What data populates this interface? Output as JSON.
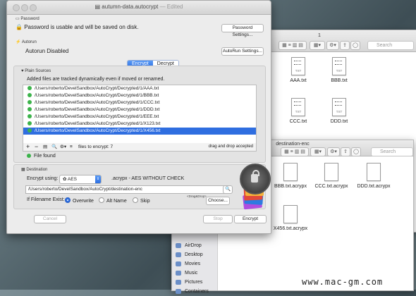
{
  "window": {
    "title": "autumn-data.autocrypt",
    "edited": "— Edited"
  },
  "password": {
    "header": "Password",
    "status": "Password is usable and will be saved on disk.",
    "settings_button": "Password Settings..."
  },
  "autorun": {
    "header": "Autorun",
    "status": "Autorun Disabled",
    "settings_button": "AutoRun Settings..."
  },
  "mode_tabs": [
    {
      "label": "Encrypt",
      "selected": true
    },
    {
      "label": "Decrypt",
      "selected": false
    }
  ],
  "plain_sources": {
    "header": "Plain Sources",
    "note": "Added files are tracked dynamically  even if moved or renamed.",
    "files": [
      "/Users/roberto/DevelSandbox/AutoCrypt/Decrypted/1/AAA.txt",
      "/Users/roberto/DevelSandbox/AutoCrypt/Decrypted/1/BBB.txt",
      "/Users/roberto/DevelSandbox/AutoCrypt/Decrypted/1/CCC.txt",
      "/Users/roberto/DevelSandbox/AutoCrypt/Decrypted/1/DDD.txt",
      "/Users/roberto/DevelSandbox/AutoCrypt/Decrypted/1/EEE.txt",
      "/Users/roberto/DevelSandbox/AutoCrypt/Decrypted/1/X123.txt",
      "/Users/roberto/DevelSandbox/AutoCrypt/Decrypted/1/X456.txt"
    ],
    "selected_index": 6,
    "add_label": "+",
    "remove_label": "−",
    "files_count": "files to encrypt: 7",
    "drag_hint": "drag and drop accepted",
    "status": "File found"
  },
  "destination": {
    "header": "Destination",
    "encrypt_using_label": "Encrypt using:",
    "algorithm": "AES",
    "extension_note": ".acrypx - AES WITHOUT CHECK",
    "path": "/Users/roberto/DevelSandbox/AutoCrypt/destination-enc",
    "drag_drop_tag": "<Drag&Drop>",
    "choose_button": "Choose...",
    "if_exists_label": "If Filename Exist:",
    "options": [
      {
        "label": "Overwrite",
        "selected": true
      },
      {
        "label": "Alt Name",
        "selected": false
      },
      {
        "label": "Skip",
        "selected": false
      }
    ]
  },
  "footer": {
    "cancel": "Cancel",
    "stop": "Stop",
    "encrypt": "Encrypt"
  },
  "finder_back": {
    "title": "1",
    "search_placeholder": "Search",
    "files": [
      {
        "name": "AAA.txt",
        "ext": "TXT"
      },
      {
        "name": "BBB.txt",
        "ext": "TXT"
      },
      {
        "name": "CCC.txt",
        "ext": "TXT"
      },
      {
        "name": "DDD.txt",
        "ext": "TXT"
      }
    ]
  },
  "finder_front": {
    "title": "destination-enc",
    "search_placeholder": "Search",
    "files": [
      {
        "name": "BBB.txt.acrypx"
      },
      {
        "name": "CCC.txt.acrypx"
      },
      {
        "name": "DDD.txt.acrypx"
      },
      {
        "name": "X456.txt.acrypx"
      }
    ],
    "sidebar": [
      "AirDrop",
      "Desktop",
      "Movies",
      "Music",
      "Pictures",
      "Containers"
    ]
  },
  "watermark": "www.mac-gm.com"
}
